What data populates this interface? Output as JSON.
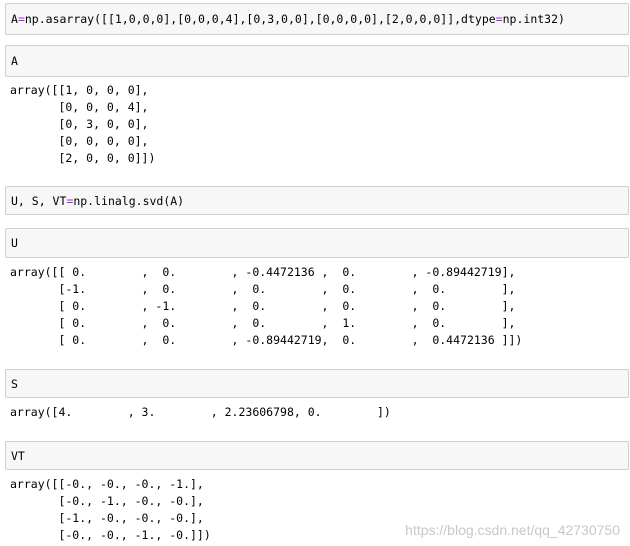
{
  "cells": {
    "cell1": {
      "name": "A",
      "op": "=",
      "code": "np.asarray([[1,0,0,0],[0,0,0,4],[0,3,0,0],[0,0,0,0],[2,0,0,0]],dtype",
      "op2": "=",
      "code2": "np.int32)"
    },
    "cell2": {
      "text": "A"
    },
    "cell3": {
      "name": "U, S, VT",
      "op": "=",
      "code": "np.linalg.svd(A)"
    },
    "cell4": {
      "text": "U"
    },
    "cell5": {
      "text": "S"
    },
    "cell6": {
      "text": "VT"
    }
  },
  "outputs": {
    "A": "array([[1, 0, 0, 0],\n       [0, 0, 0, 4],\n       [0, 3, 0, 0],\n       [0, 0, 0, 0],\n       [2, 0, 0, 0]])",
    "U": "array([[ 0.        ,  0.        , -0.4472136 ,  0.        , -0.89442719],\n       [-1.        ,  0.        ,  0.        ,  0.        ,  0.        ],\n       [ 0.        , -1.        ,  0.        ,  0.        ,  0.        ],\n       [ 0.        ,  0.        ,  0.        ,  1.        ,  0.        ],\n       [ 0.        ,  0.        , -0.89442719,  0.        ,  0.4472136 ]])",
    "S": "array([4.        , 3.        , 2.23606798, 0.        ])",
    "VT": "array([[-0., -0., -0., -1.],\n       [-0., -1., -0., -0.],\n       [-1., -0., -0., -0.],\n       [-0., -0., -1., -0.]])"
  },
  "watermark": "https://blog.csdn.net/qq_42730750"
}
